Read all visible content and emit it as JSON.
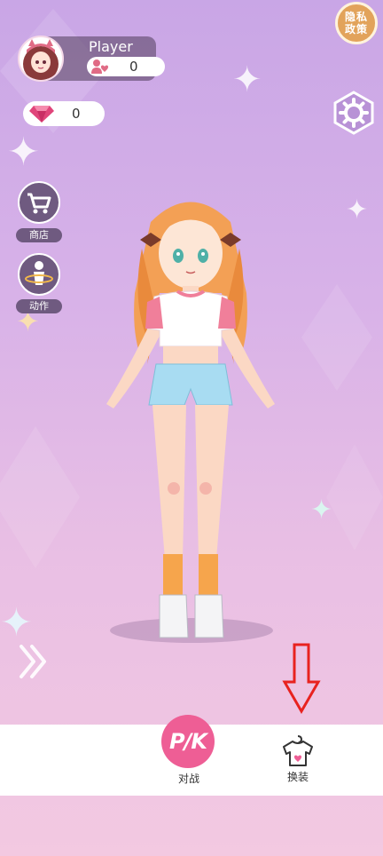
{
  "profile": {
    "name": "Player",
    "fans_count": "0"
  },
  "currency": {
    "gems": "0"
  },
  "privacy": {
    "line1": "隐私",
    "line2": "政策"
  },
  "side_menu": {
    "shop_label": "商店",
    "action_label": "动作"
  },
  "bottom_nav": {
    "battle_label": "对战",
    "battle_icon_text": "P/K",
    "outfit_label": "换装"
  },
  "colors": {
    "accent_pink": "#ee5e95",
    "panel_dark": "#6f5a80",
    "privacy_gold": "#e2a35b",
    "annotation_red": "#e8221f"
  }
}
